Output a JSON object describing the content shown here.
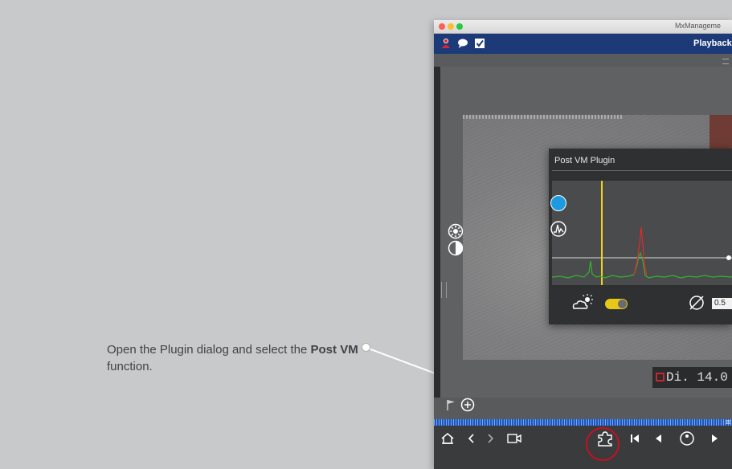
{
  "callout": {
    "text_prefix": "Open the Plugin dialog and select the ",
    "text_bold": "Post VM",
    "text_suffix": " function."
  },
  "window": {
    "title": "MxManageme",
    "header_label": "Playback"
  },
  "dialog": {
    "title": "Post VM Plugin",
    "value": "0.5"
  },
  "timestamp": "Di. 14.0",
  "icons": {
    "header": [
      "user-icon",
      "chat-icon",
      "checkbox-icon"
    ],
    "side": [
      "brightness-icon",
      "contrast-icon"
    ],
    "toolbar": [
      "home-icon",
      "back-icon",
      "forward-icon",
      "camera-icon",
      "plugin-icon",
      "skip-start-icon",
      "prev-icon",
      "record-icon",
      "play-icon"
    ]
  },
  "colors": {
    "header_blue": "#1d3a78",
    "highlight_red": "#c8101f",
    "toggle_yellow": "#e8c816",
    "color_dot_blue": "#1e9be0"
  }
}
